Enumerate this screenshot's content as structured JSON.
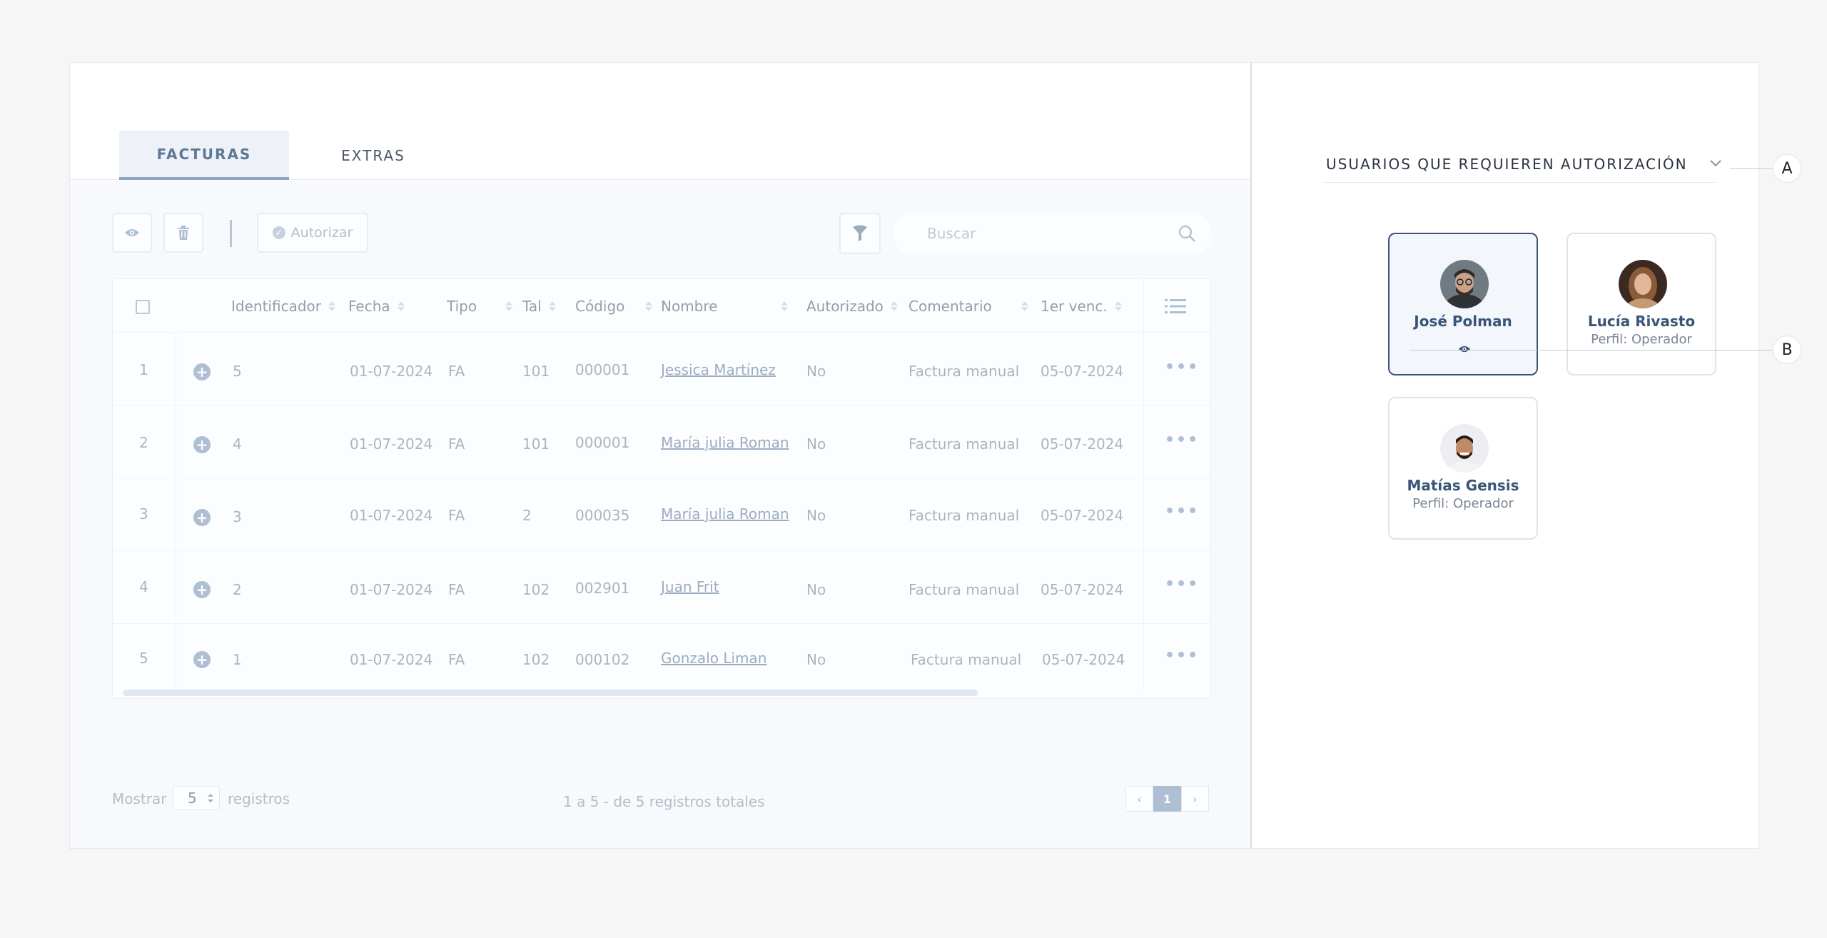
{
  "tabs": [
    {
      "label": "FACTURAS",
      "active": true
    },
    {
      "label": "EXTRAS",
      "active": false
    }
  ],
  "toolbar": {
    "view_icon": "eye-icon",
    "delete_icon": "trash-icon",
    "authorize_label": "Autorizar",
    "filter_icon": "filter-icon",
    "search_placeholder": "Buscar"
  },
  "table": {
    "columns": [
      "Identificador",
      "Fecha",
      "Tipo",
      "Tal",
      "Código",
      "Nombre",
      "Autorizado",
      "Comentario",
      "1er venc."
    ],
    "rows": [
      {
        "n": "1",
        "id": "5",
        "fecha": "01-07-2024",
        "tipo": "FA",
        "tal": "101",
        "codigo": "000001",
        "nombre": "Jessica Martínez",
        "autorizado": "No",
        "comentario": "Factura manual",
        "venc": "05-07-2024"
      },
      {
        "n": "2",
        "id": "4",
        "fecha": "01-07-2024",
        "tipo": "FA",
        "tal": "101",
        "codigo": "000001",
        "nombre": "María julia Roman",
        "autorizado": "No",
        "comentario": "Factura manual",
        "venc": "05-07-2024"
      },
      {
        "n": "3",
        "id": "3",
        "fecha": "01-07-2024",
        "tipo": "FA",
        "tal": "2",
        "codigo": "000035",
        "nombre": "María julia Roman",
        "autorizado": "No",
        "comentario": "Factura manual",
        "venc": "05-07-2024"
      },
      {
        "n": "4",
        "id": "2",
        "fecha": "01-07-2024",
        "tipo": "FA",
        "tal": "102",
        "codigo": "002901",
        "nombre": "Juan Frit",
        "autorizado": "No",
        "comentario": "Factura manual",
        "venc": "05-07-2024"
      },
      {
        "n": "5",
        "id": "1",
        "fecha": "01-07-2024",
        "tipo": "FA",
        "tal": "102",
        "codigo": "000102",
        "nombre": "Gonzalo Liman",
        "autorizado": "No",
        "comentario": "Factura manual",
        "venc": "05-07-2024"
      }
    ]
  },
  "footer": {
    "show_label": "Mostrar",
    "page_size": "5",
    "records_label": "registros",
    "total_text": "1 a 5 - de 5 registros totales",
    "current_page": "1"
  },
  "panel": {
    "title": "USUARIOS QUE REQUIEREN AUTORIZACIÓN",
    "users": [
      {
        "name": "José Polman",
        "profile": "",
        "selected": true
      },
      {
        "name": "Lucía Rivasto",
        "profile": "Perfil: Operador",
        "selected": false
      },
      {
        "name": "Matías Gensis",
        "profile": "Perfil: Operador",
        "selected": false
      }
    ]
  },
  "callouts": [
    "A",
    "B"
  ],
  "colors": {
    "accent": "#3a5578",
    "muted_accent": "#7f98b8",
    "background": "#f6f6f6"
  }
}
